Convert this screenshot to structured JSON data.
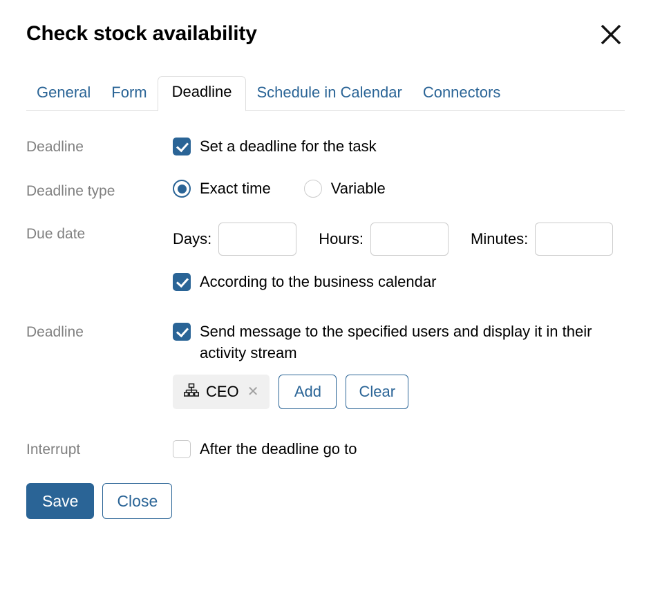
{
  "dialog": {
    "title": "Check stock availability",
    "close_icon": "close-icon"
  },
  "tabs": [
    {
      "label": "General",
      "active": false
    },
    {
      "label": "Form",
      "active": false
    },
    {
      "label": "Deadline",
      "active": true
    },
    {
      "label": "Schedule in Calendar",
      "active": false
    },
    {
      "label": "Connectors",
      "active": false
    }
  ],
  "rows": {
    "deadline": {
      "label": "Deadline",
      "checkbox_label": "Set a deadline for the task",
      "checked": true
    },
    "deadline_type": {
      "label": "Deadline type",
      "options": [
        {
          "label": "Exact time",
          "selected": true
        },
        {
          "label": "Variable",
          "selected": false
        }
      ]
    },
    "due_date": {
      "label": "Due date",
      "fields": [
        {
          "label": "Days:",
          "value": "",
          "placeholder": ""
        },
        {
          "label": "Hours:",
          "value": "",
          "placeholder": ""
        },
        {
          "label": "Minutes:",
          "value": "",
          "placeholder": ""
        }
      ],
      "business_calendar_label": "According to the business calendar",
      "business_calendar_checked": true
    },
    "deadline_notify": {
      "label": "Deadline",
      "checkbox_label": "Send message to the specified users and display it in their activity stream",
      "checked": true,
      "tags": [
        {
          "text": "CEO",
          "icon": "sitemap-icon",
          "remove_icon": "close-small-icon"
        }
      ],
      "add_label": "Add",
      "clear_label": "Clear"
    },
    "interrupt": {
      "label": "Interrupt",
      "checkbox_label": "After the deadline go to",
      "checked": false
    }
  },
  "footer": {
    "save_label": "Save",
    "close_label": "Close"
  },
  "colors": {
    "accent": "#2a6496",
    "label_gray": "#808080",
    "border_gray": "#cccccc",
    "tag_bg": "#f0f0f0",
    "text": "#000000"
  }
}
